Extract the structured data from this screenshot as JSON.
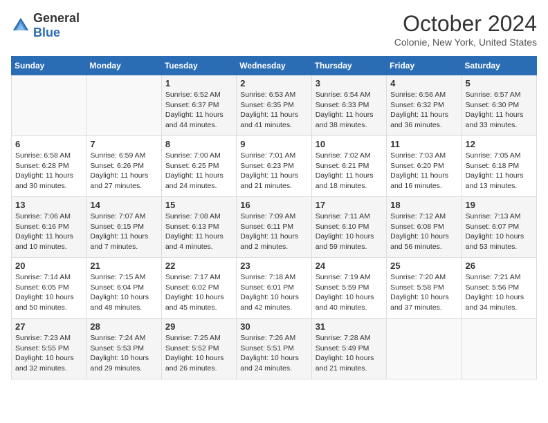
{
  "header": {
    "logo_general": "General",
    "logo_blue": "Blue",
    "month": "October 2024",
    "location": "Colonie, New York, United States"
  },
  "days_of_week": [
    "Sunday",
    "Monday",
    "Tuesday",
    "Wednesday",
    "Thursday",
    "Friday",
    "Saturday"
  ],
  "weeks": [
    [
      {
        "day": null
      },
      {
        "day": null
      },
      {
        "day": "1",
        "sunrise": "6:52 AM",
        "sunset": "6:37 PM",
        "daylight": "11 hours and 44 minutes."
      },
      {
        "day": "2",
        "sunrise": "6:53 AM",
        "sunset": "6:35 PM",
        "daylight": "11 hours and 41 minutes."
      },
      {
        "day": "3",
        "sunrise": "6:54 AM",
        "sunset": "6:33 PM",
        "daylight": "11 hours and 38 minutes."
      },
      {
        "day": "4",
        "sunrise": "6:56 AM",
        "sunset": "6:32 PM",
        "daylight": "11 hours and 36 minutes."
      },
      {
        "day": "5",
        "sunrise": "6:57 AM",
        "sunset": "6:30 PM",
        "daylight": "11 hours and 33 minutes."
      }
    ],
    [
      {
        "day": "6",
        "sunrise": "6:58 AM",
        "sunset": "6:28 PM",
        "daylight": "11 hours and 30 minutes."
      },
      {
        "day": "7",
        "sunrise": "6:59 AM",
        "sunset": "6:26 PM",
        "daylight": "11 hours and 27 minutes."
      },
      {
        "day": "8",
        "sunrise": "7:00 AM",
        "sunset": "6:25 PM",
        "daylight": "11 hours and 24 minutes."
      },
      {
        "day": "9",
        "sunrise": "7:01 AM",
        "sunset": "6:23 PM",
        "daylight": "11 hours and 21 minutes."
      },
      {
        "day": "10",
        "sunrise": "7:02 AM",
        "sunset": "6:21 PM",
        "daylight": "11 hours and 18 minutes."
      },
      {
        "day": "11",
        "sunrise": "7:03 AM",
        "sunset": "6:20 PM",
        "daylight": "11 hours and 16 minutes."
      },
      {
        "day": "12",
        "sunrise": "7:05 AM",
        "sunset": "6:18 PM",
        "daylight": "11 hours and 13 minutes."
      }
    ],
    [
      {
        "day": "13",
        "sunrise": "7:06 AM",
        "sunset": "6:16 PM",
        "daylight": "11 hours and 10 minutes."
      },
      {
        "day": "14",
        "sunrise": "7:07 AM",
        "sunset": "6:15 PM",
        "daylight": "11 hours and 7 minutes."
      },
      {
        "day": "15",
        "sunrise": "7:08 AM",
        "sunset": "6:13 PM",
        "daylight": "11 hours and 4 minutes."
      },
      {
        "day": "16",
        "sunrise": "7:09 AM",
        "sunset": "6:11 PM",
        "daylight": "11 hours and 2 minutes."
      },
      {
        "day": "17",
        "sunrise": "7:11 AM",
        "sunset": "6:10 PM",
        "daylight": "10 hours and 59 minutes."
      },
      {
        "day": "18",
        "sunrise": "7:12 AM",
        "sunset": "6:08 PM",
        "daylight": "10 hours and 56 minutes."
      },
      {
        "day": "19",
        "sunrise": "7:13 AM",
        "sunset": "6:07 PM",
        "daylight": "10 hours and 53 minutes."
      }
    ],
    [
      {
        "day": "20",
        "sunrise": "7:14 AM",
        "sunset": "6:05 PM",
        "daylight": "10 hours and 50 minutes."
      },
      {
        "day": "21",
        "sunrise": "7:15 AM",
        "sunset": "6:04 PM",
        "daylight": "10 hours and 48 minutes."
      },
      {
        "day": "22",
        "sunrise": "7:17 AM",
        "sunset": "6:02 PM",
        "daylight": "10 hours and 45 minutes."
      },
      {
        "day": "23",
        "sunrise": "7:18 AM",
        "sunset": "6:01 PM",
        "daylight": "10 hours and 42 minutes."
      },
      {
        "day": "24",
        "sunrise": "7:19 AM",
        "sunset": "5:59 PM",
        "daylight": "10 hours and 40 minutes."
      },
      {
        "day": "25",
        "sunrise": "7:20 AM",
        "sunset": "5:58 PM",
        "daylight": "10 hours and 37 minutes."
      },
      {
        "day": "26",
        "sunrise": "7:21 AM",
        "sunset": "5:56 PM",
        "daylight": "10 hours and 34 minutes."
      }
    ],
    [
      {
        "day": "27",
        "sunrise": "7:23 AM",
        "sunset": "5:55 PM",
        "daylight": "10 hours and 32 minutes."
      },
      {
        "day": "28",
        "sunrise": "7:24 AM",
        "sunset": "5:53 PM",
        "daylight": "10 hours and 29 minutes."
      },
      {
        "day": "29",
        "sunrise": "7:25 AM",
        "sunset": "5:52 PM",
        "daylight": "10 hours and 26 minutes."
      },
      {
        "day": "30",
        "sunrise": "7:26 AM",
        "sunset": "5:51 PM",
        "daylight": "10 hours and 24 minutes."
      },
      {
        "day": "31",
        "sunrise": "7:28 AM",
        "sunset": "5:49 PM",
        "daylight": "10 hours and 21 minutes."
      },
      {
        "day": null
      },
      {
        "day": null
      }
    ]
  ]
}
